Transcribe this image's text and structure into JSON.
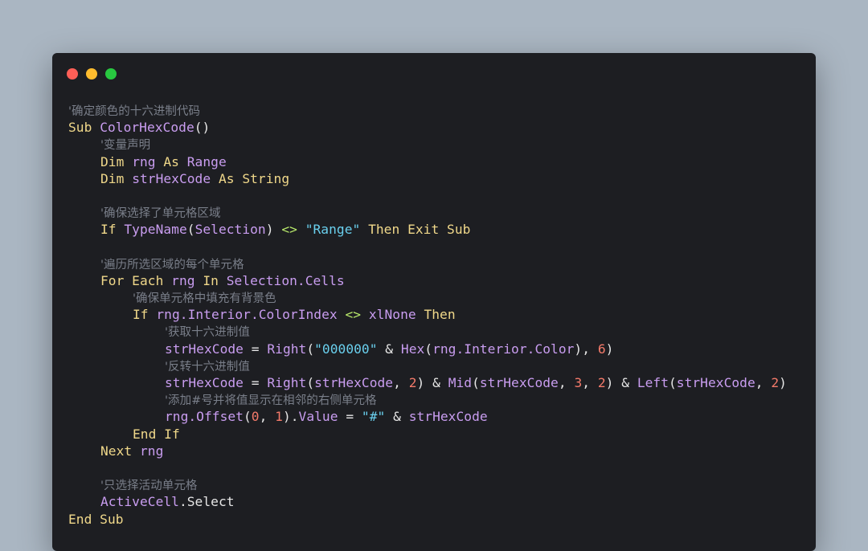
{
  "window": {
    "traffic_lights": [
      {
        "name": "close-dot",
        "color": "#fe5f57"
      },
      {
        "name": "minimize-dot",
        "color": "#febc2e"
      },
      {
        "name": "maximize-dot",
        "color": "#28c840"
      }
    ]
  },
  "code": {
    "lines": [
      {
        "indent": 0,
        "tokens": [
          {
            "t": "cm",
            "v": "'确定颜色的十六进制代码"
          }
        ]
      },
      {
        "indent": 0,
        "tokens": [
          {
            "t": "kw",
            "v": "Sub "
          },
          {
            "t": "fn",
            "v": "ColorHexCode"
          },
          {
            "t": "pl",
            "v": "()"
          }
        ]
      },
      {
        "indent": 1,
        "tokens": [
          {
            "t": "cm",
            "v": "'变量声明"
          }
        ]
      },
      {
        "indent": 1,
        "tokens": [
          {
            "t": "kw",
            "v": "Dim "
          },
          {
            "t": "id",
            "v": "rng"
          },
          {
            "t": "kw",
            "v": " As "
          },
          {
            "t": "fn",
            "v": "Range"
          }
        ]
      },
      {
        "indent": 1,
        "tokens": [
          {
            "t": "kw",
            "v": "Dim "
          },
          {
            "t": "id",
            "v": "strHexCode"
          },
          {
            "t": "kw",
            "v": " As String"
          }
        ]
      },
      {
        "indent": 0,
        "tokens": []
      },
      {
        "indent": 1,
        "tokens": [
          {
            "t": "cm",
            "v": "'确保选择了单元格区域"
          }
        ]
      },
      {
        "indent": 1,
        "tokens": [
          {
            "t": "kw",
            "v": "If "
          },
          {
            "t": "fn",
            "v": "TypeName"
          },
          {
            "t": "pl",
            "v": "("
          },
          {
            "t": "id",
            "v": "Selection"
          },
          {
            "t": "pl",
            "v": ") "
          },
          {
            "t": "opg",
            "v": "<>"
          },
          {
            "t": "pl",
            "v": " "
          },
          {
            "t": "str",
            "v": "\"Range\""
          },
          {
            "t": "kw",
            "v": " Then Exit Sub"
          }
        ]
      },
      {
        "indent": 0,
        "tokens": []
      },
      {
        "indent": 1,
        "tokens": [
          {
            "t": "cm",
            "v": "'遍历所选区域的每个单元格"
          }
        ]
      },
      {
        "indent": 1,
        "tokens": [
          {
            "t": "kw",
            "v": "For Each "
          },
          {
            "t": "id",
            "v": "rng"
          },
          {
            "t": "kw",
            "v": " In "
          },
          {
            "t": "id",
            "v": "Selection.Cells"
          }
        ]
      },
      {
        "indent": 2,
        "tokens": [
          {
            "t": "cm",
            "v": "'确保单元格中填充有背景色"
          }
        ]
      },
      {
        "indent": 2,
        "tokens": [
          {
            "t": "kw",
            "v": "If "
          },
          {
            "t": "id",
            "v": "rng.Interior.ColorIndex"
          },
          {
            "t": "pl",
            "v": " "
          },
          {
            "t": "opg",
            "v": "<>"
          },
          {
            "t": "pl",
            "v": " "
          },
          {
            "t": "id",
            "v": "xlNone"
          },
          {
            "t": "kw",
            "v": " Then"
          }
        ]
      },
      {
        "indent": 3,
        "tokens": [
          {
            "t": "cm",
            "v": "'获取十六进制值"
          }
        ]
      },
      {
        "indent": 3,
        "tokens": [
          {
            "t": "id",
            "v": "strHexCode"
          },
          {
            "t": "pl",
            "v": " = "
          },
          {
            "t": "fn",
            "v": "Right"
          },
          {
            "t": "pl",
            "v": "("
          },
          {
            "t": "str",
            "v": "\"000000\""
          },
          {
            "t": "pl",
            "v": " & "
          },
          {
            "t": "fn",
            "v": "Hex"
          },
          {
            "t": "pl",
            "v": "("
          },
          {
            "t": "id",
            "v": "rng.Interior.Color"
          },
          {
            "t": "pl",
            "v": "), "
          },
          {
            "t": "num",
            "v": "6"
          },
          {
            "t": "pl",
            "v": ")"
          }
        ]
      },
      {
        "indent": 3,
        "tokens": [
          {
            "t": "cm",
            "v": "'反转十六进制值"
          }
        ]
      },
      {
        "indent": 3,
        "tokens": [
          {
            "t": "id",
            "v": "strHexCode"
          },
          {
            "t": "pl",
            "v": " = "
          },
          {
            "t": "fn",
            "v": "Right"
          },
          {
            "t": "pl",
            "v": "("
          },
          {
            "t": "id",
            "v": "strHexCode"
          },
          {
            "t": "pl",
            "v": ", "
          },
          {
            "t": "num",
            "v": "2"
          },
          {
            "t": "pl",
            "v": ") & "
          },
          {
            "t": "fn",
            "v": "Mid"
          },
          {
            "t": "pl",
            "v": "("
          },
          {
            "t": "id",
            "v": "strHexCode"
          },
          {
            "t": "pl",
            "v": ", "
          },
          {
            "t": "num",
            "v": "3"
          },
          {
            "t": "pl",
            "v": ", "
          },
          {
            "t": "num",
            "v": "2"
          },
          {
            "t": "pl",
            "v": ") & "
          },
          {
            "t": "fn",
            "v": "Left"
          },
          {
            "t": "pl",
            "v": "("
          },
          {
            "t": "id",
            "v": "strHexCode"
          },
          {
            "t": "pl",
            "v": ", "
          },
          {
            "t": "num",
            "v": "2"
          },
          {
            "t": "pl",
            "v": ")"
          }
        ]
      },
      {
        "indent": 3,
        "tokens": [
          {
            "t": "cm",
            "v": "'添加#号并将值显示在相邻的右侧单元格"
          }
        ]
      },
      {
        "indent": 3,
        "tokens": [
          {
            "t": "id",
            "v": "rng.Offset"
          },
          {
            "t": "pl",
            "v": "("
          },
          {
            "t": "num",
            "v": "0"
          },
          {
            "t": "pl",
            "v": ", "
          },
          {
            "t": "num",
            "v": "1"
          },
          {
            "t": "pl",
            "v": ")."
          },
          {
            "t": "id",
            "v": "Value"
          },
          {
            "t": "pl",
            "v": " = "
          },
          {
            "t": "str",
            "v": "\"#\""
          },
          {
            "t": "pl",
            "v": " & "
          },
          {
            "t": "id",
            "v": "strHexCode"
          }
        ]
      },
      {
        "indent": 2,
        "tokens": [
          {
            "t": "kw",
            "v": "End If"
          }
        ]
      },
      {
        "indent": 1,
        "tokens": [
          {
            "t": "kw",
            "v": "Next "
          },
          {
            "t": "id",
            "v": "rng"
          }
        ]
      },
      {
        "indent": 0,
        "tokens": []
      },
      {
        "indent": 1,
        "tokens": [
          {
            "t": "cm",
            "v": "'只选择活动单元格"
          }
        ]
      },
      {
        "indent": 1,
        "tokens": [
          {
            "t": "id",
            "v": "ActiveCell"
          },
          {
            "t": "pl",
            "v": ".Select"
          }
        ]
      },
      {
        "indent": 0,
        "tokens": [
          {
            "t": "kw",
            "v": "End Sub"
          }
        ]
      }
    ]
  }
}
